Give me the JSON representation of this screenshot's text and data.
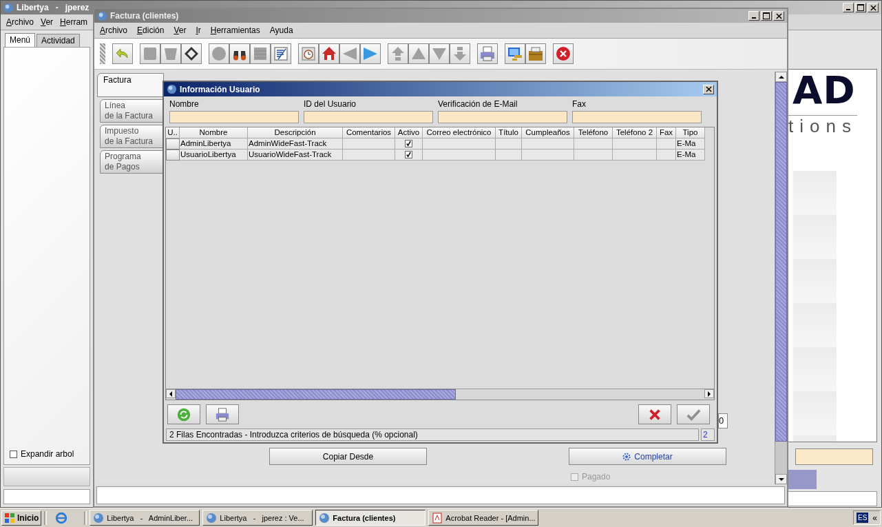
{
  "desktop_window": {
    "title": "Libertya   -   jperez",
    "menu": [
      {
        "label": "Archivo",
        "mnemonic": true
      },
      {
        "label": "Ver",
        "mnemonic": true
      },
      {
        "label": "Herram",
        "mnemonic": true
      }
    ],
    "tabs": [
      {
        "label": "Menú",
        "selected": true
      },
      {
        "label": "Actividad",
        "selected": false
      }
    ],
    "expand_tree": {
      "label": "Expandir arbol",
      "checked": false
    },
    "logo": {
      "mark": "AD",
      "text": "tions"
    }
  },
  "invoice_window": {
    "title": "Factura (clientes)",
    "menu": [
      {
        "label": "Archivo",
        "mnemonic": true
      },
      {
        "label": "Edición",
        "mnemonic": true
      },
      {
        "label": "Ver",
        "mnemonic": true
      },
      {
        "label": "Ir",
        "mnemonic": true
      },
      {
        "label": "Herramientas",
        "mnemonic": true
      },
      {
        "label": "Ayuda",
        "mnemonic": false
      }
    ],
    "toolbar_groups": [
      [
        {
          "kind": "undo",
          "disabled": false
        }
      ],
      [
        {
          "kind": "new",
          "disabled": true
        },
        {
          "kind": "delete",
          "disabled": true
        },
        {
          "kind": "save",
          "disabled": false
        }
      ],
      [
        {
          "kind": "refresh",
          "disabled": true
        },
        {
          "kind": "find",
          "disabled": false
        },
        {
          "kind": "grid",
          "disabled": true
        },
        {
          "kind": "report",
          "disabled": false
        }
      ],
      [
        {
          "kind": "history",
          "disabled": false
        },
        {
          "kind": "home",
          "disabled": false
        },
        {
          "kind": "previous",
          "disabled": true
        },
        {
          "kind": "next",
          "disabled": false
        }
      ],
      [
        {
          "kind": "first",
          "disabled": true
        },
        {
          "kind": "up",
          "disabled": true
        },
        {
          "kind": "down",
          "disabled": true
        },
        {
          "kind": "last",
          "disabled": true
        }
      ],
      [
        {
          "kind": "print",
          "disabled": false
        }
      ],
      [
        {
          "kind": "export",
          "disabled": false
        },
        {
          "kind": "archive",
          "disabled": false
        }
      ],
      [
        {
          "kind": "exit",
          "disabled": false
        }
      ]
    ],
    "side_tabs": [
      {
        "label": "Factura",
        "selected": true
      },
      {
        "label": "Línea\nde la Factura",
        "selected": false
      },
      {
        "label": "Impuesto\nde la Factura",
        "selected": false
      },
      {
        "label": "Programa\nde Pagos",
        "selected": false
      }
    ],
    "partial_field": "0",
    "copy_button": "Copiar Desde",
    "complete_button": "Completar",
    "paid": {
      "label": "Pagado",
      "checked": false,
      "disabled": true
    }
  },
  "user_dialog": {
    "title": "Información Usuario",
    "filters": [
      {
        "label": "Nombre"
      },
      {
        "label": "ID del Usuario"
      },
      {
        "label": "Verificación de E-Mail"
      },
      {
        "label": "Fax"
      }
    ],
    "columns": [
      {
        "kind": "select",
        "label": "U.."
      },
      {
        "kind": "nombre",
        "label": "Nombre"
      },
      {
        "kind": "descripcion",
        "label": "Descripción"
      },
      {
        "kind": "comentarios",
        "label": "Comentarios"
      },
      {
        "kind": "activo",
        "label": "Activo"
      },
      {
        "kind": "correo",
        "label": "Correo electrónico"
      },
      {
        "kind": "titulo",
        "label": "Título"
      },
      {
        "kind": "cumpleanos",
        "label": "Cumpleaños"
      },
      {
        "kind": "telefono",
        "label": "Teléfono"
      },
      {
        "kind": "telefono2",
        "label": "Teléfono 2"
      },
      {
        "kind": "fax",
        "label": "Fax"
      },
      {
        "kind": "tipo",
        "label": "Tipo"
      }
    ],
    "rows": [
      {
        "nombre": "AdminLibertya",
        "descripcion": "AdminWideFast-Track",
        "activo": true,
        "tipo": "E-Ma"
      },
      {
        "nombre": "UsuarioLibertya",
        "descripcion": "UsuarioWideFast-Track",
        "activo": true,
        "tipo": "E-Ma"
      }
    ],
    "status": "2 Filas Encontradas - Introduzca criterios de búsqueda (% opcional)",
    "count": "2"
  },
  "taskbar": {
    "start": "Inicio",
    "tasks": [
      {
        "kind": "libertya",
        "label": "Libertya   -   AdminLiber...",
        "selected": false
      },
      {
        "kind": "libertya",
        "label": "Libertya   -   jperez : Ve...",
        "selected": false
      },
      {
        "kind": "libertya",
        "label": "Factura (clientes)",
        "selected": true
      },
      {
        "kind": "acrobat",
        "label": "Acrobat Reader - [Admin...",
        "selected": false
      }
    ],
    "language": "ES",
    "expand": "«"
  }
}
